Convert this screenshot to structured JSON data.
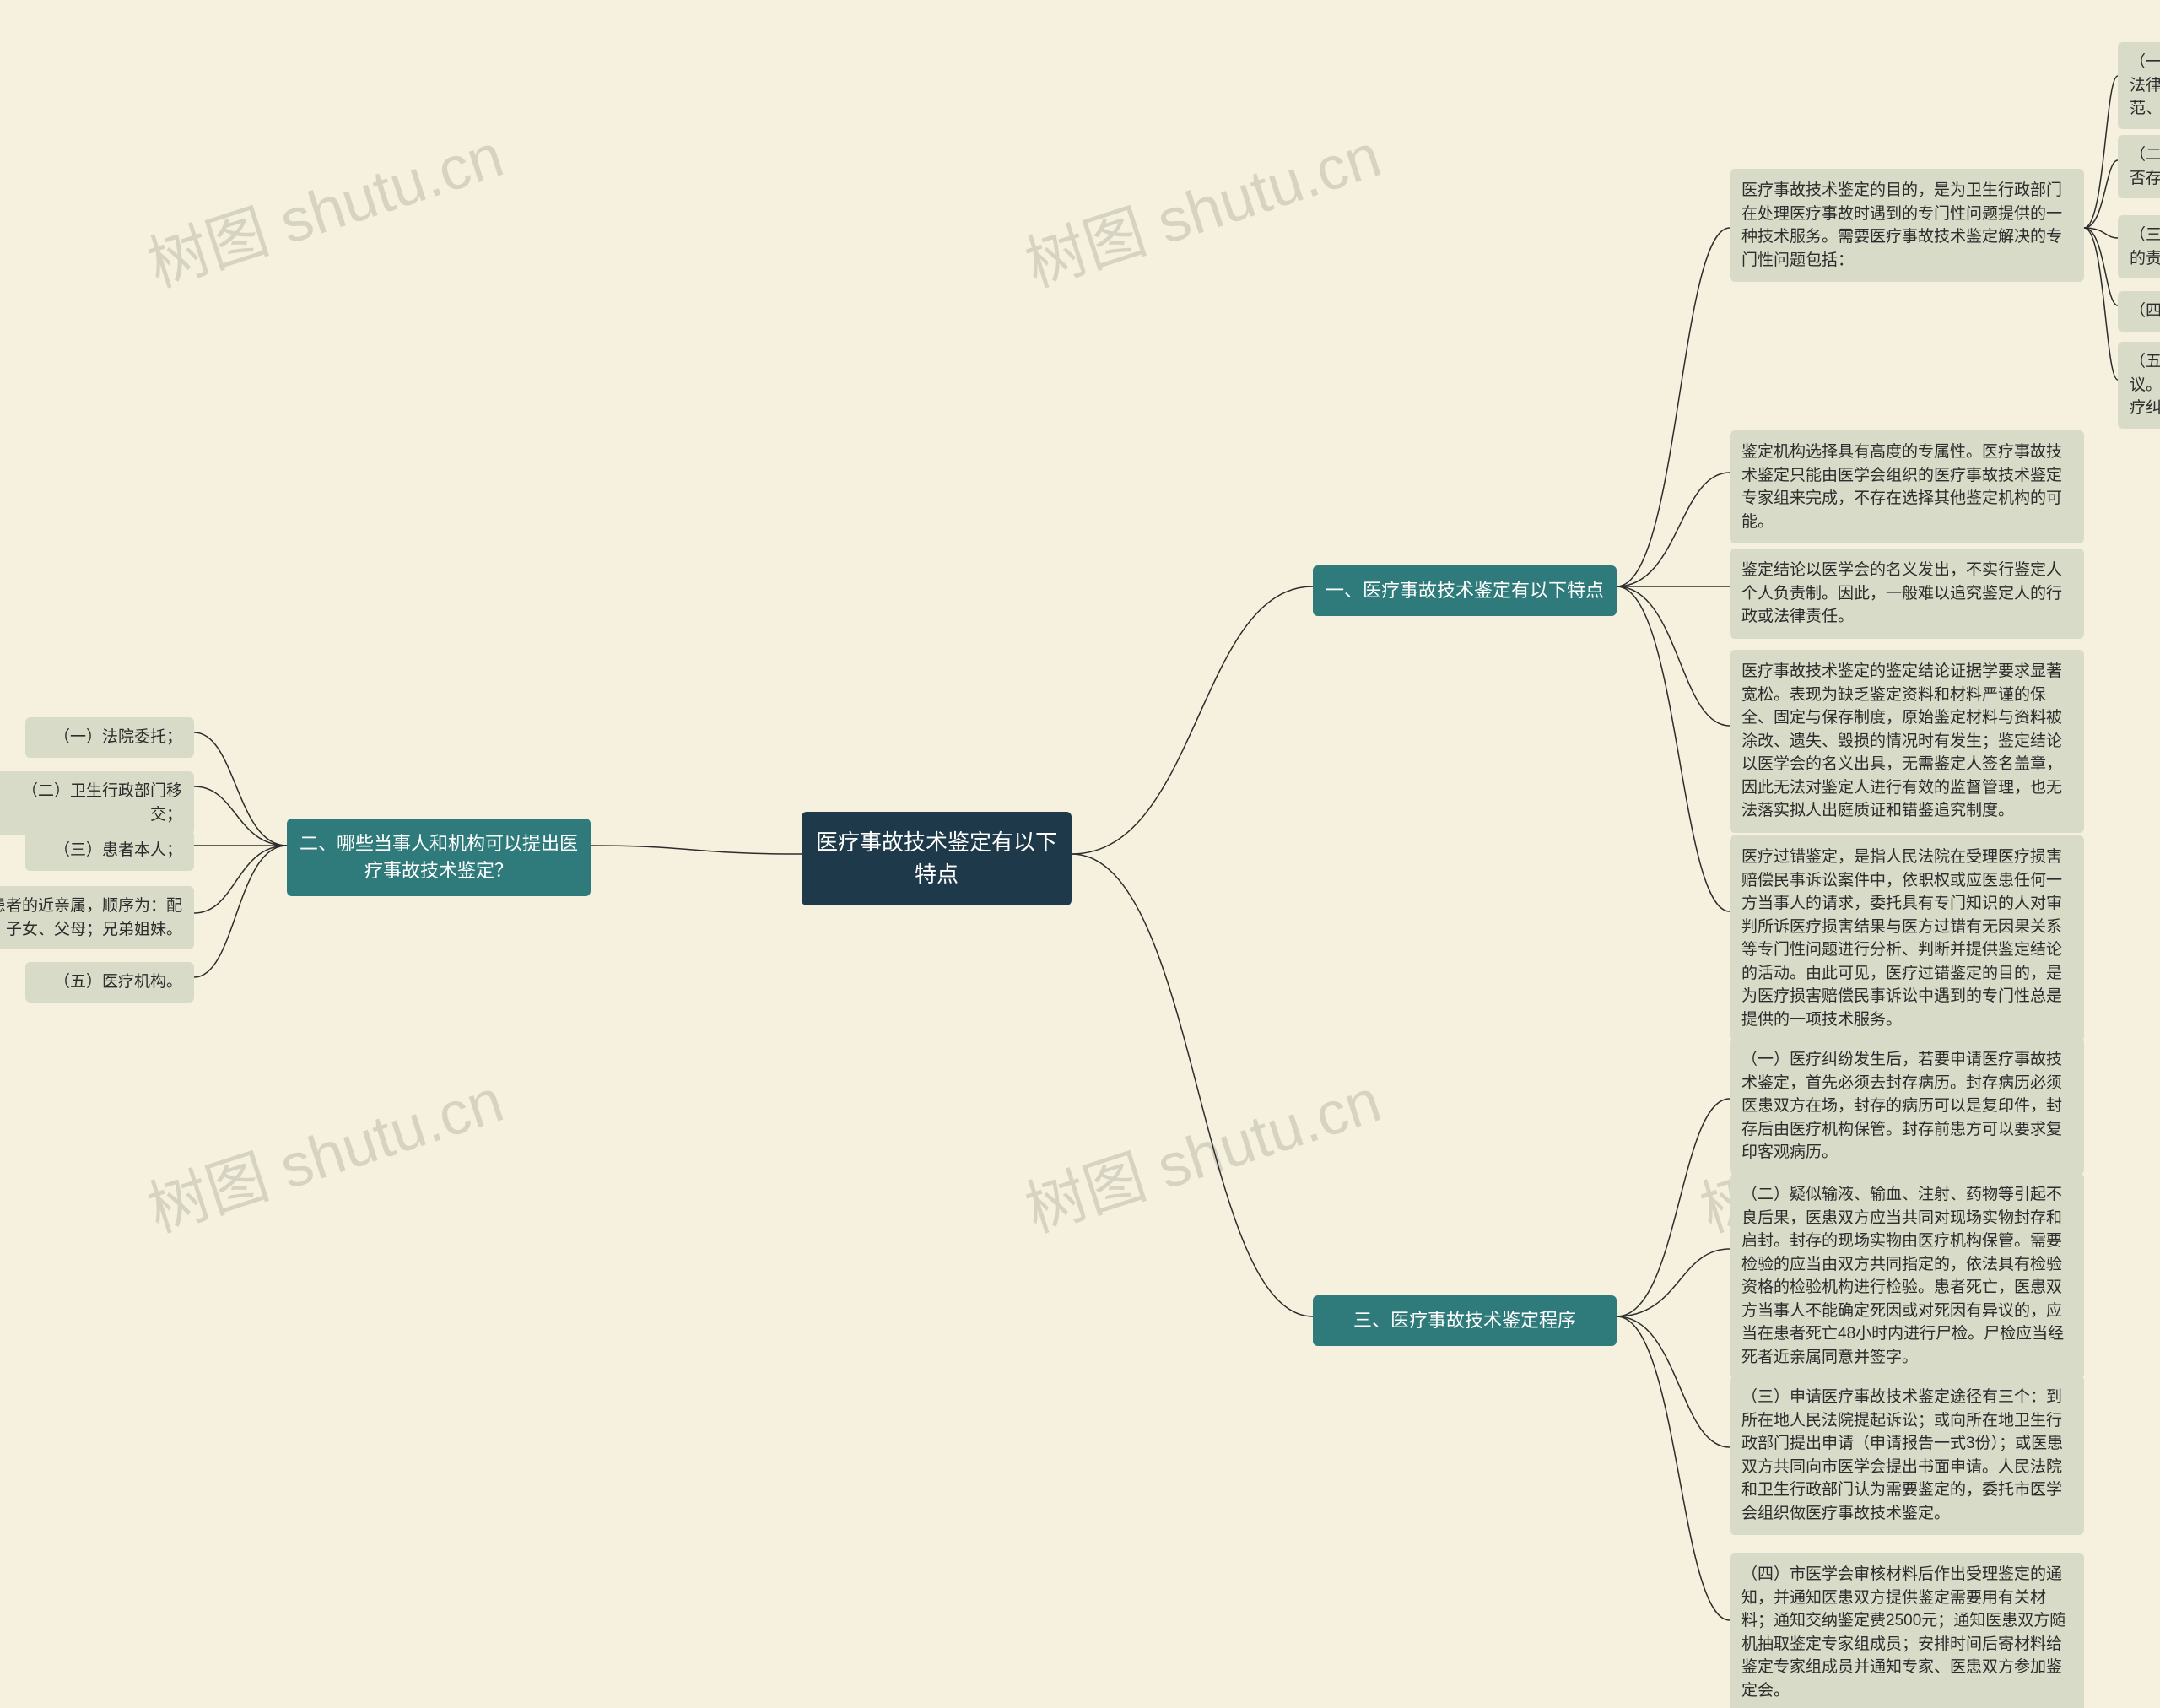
{
  "watermark": "树图 shutu.cn",
  "root": {
    "text": "医疗事故技术鉴定有以下特点"
  },
  "branches": {
    "b1": {
      "text": "一、医疗事故技术鉴定有以下特点"
    },
    "b2": {
      "text": "二、哪些当事人和机构可以提出医疗事故技术鉴定？"
    },
    "b3": {
      "text": "三、医疗事故技术鉴定程序"
    }
  },
  "b1_children": {
    "c1": {
      "text": "医疗事故技术鉴定的目的，是为卫生行政部门在处理医疗事故时遇到的专门性问题提供的一种技术服务。需要医疗事故技术鉴定解决的专门性问题包括："
    },
    "c2": {
      "text": "鉴定机构选择具有高度的专属性。医疗事故技术鉴定只能由医学会组织的医疗事故技术鉴定专家组来完成，不存在选择其他鉴定机构的可能。"
    },
    "c3": {
      "text": "鉴定结论以医学会的名义发出，不实行鉴定人个人负责制。因此，一般难以追究鉴定人的行政或法律责任。"
    },
    "c4": {
      "text": "医疗事故技术鉴定的鉴定结论证据学要求显著宽松。表现为缺乏鉴定资料和材料严谨的保全、固定与保存制度，原始鉴定材料与资料被涂改、遗失、毁损的情况时有发生；鉴定结论以医学会的名义出具，无需鉴定人签名盖章，因此无法对鉴定人进行有效的监督管理，也无法落实拟人出庭质证和错鉴追究制度。"
    },
    "c5": {
      "text": "医疗过错鉴定，是指人民法院在受理医疗损害赔偿民事诉讼案件中，依职权或应医患任何一方当事人的请求，委托具有专门知识的人对审判所诉医疗损害结果与医方过错有无因果关系等专门性问题进行分析、判断并提供鉴定结论的活动。由此可见，医疗过错鉴定的目的，是为医疗损害赔偿民事诉讼中遇到的专门性总是提供的一项技术服务。"
    }
  },
  "b1_c1_leaves": {
    "l1": {
      "text": "（一）判断医疗行为是否违反医疗卫生管理法律、行政法规、部门规章和诊疗护理规范、常规；"
    },
    "l2": {
      "text": "（二）医疗过失行为与人身损害后果之间是否存在因果关系；"
    },
    "l3": {
      "text": "（三）医疗过失行为在医疗事故损害后果中的责任程序；"
    },
    "l4": {
      "text": "（四）医疗事故等级；"
    },
    "l5": {
      "text": "（五）对医疗事故患者的医疗护理医学建议。这些专门性问题是卫生行政部门处理医疗纠纷与事故的前提与基础。"
    }
  },
  "b2_leaves": {
    "l1": {
      "text": "（一）法院委托；"
    },
    "l2": {
      "text": "（二）卫生行政部门移交；"
    },
    "l3": {
      "text": "（三）患者本人；"
    },
    "l4": {
      "text": "（四）死亡患者的近亲属，顺序为：配偶；子女、父母；兄弟姐妹。"
    },
    "l5": {
      "text": "（五）医疗机构。"
    }
  },
  "b3_leaves": {
    "l1": {
      "text": "（一）医疗纠纷发生后，若要申请医疗事故技术鉴定，首先必须去封存病历。封存病历必须医患双方在场，封存的病历可以是复印件，封存后由医疗机构保管。封存前患方可以要求复印客观病历。"
    },
    "l2": {
      "text": "（二）疑似输液、输血、注射、药物等引起不良后果，医患双方应当共同对现场实物封存和启封。封存的现场实物由医疗机构保管。需要检验的应当由双方共同指定的，依法具有检验资格的检验机构进行检验。患者死亡，医患双方当事人不能确定死因或对死因有异议的，应当在患者死亡48小时内进行尸检。尸检应当经死者近亲属同意并签字。"
    },
    "l3": {
      "text": "（三）申请医疗事故技术鉴定途径有三个：到所在地人民法院提起诉讼；或向所在地卫生行政部门提出申请（申请报告一式3份）；或医患双方共同向市医学会提出书面申请。人民法院和卫生行政部门认为需要鉴定的，委托市医学会组织做医疗事故技术鉴定。"
    },
    "l4": {
      "text": "（四）市医学会审核材料后作出受理鉴定的通知，并通知医患双方提供鉴定需要用有关材料；通知交纳鉴定费2500元；通知医患双方随机抽取鉴定专家组成员；安排时间后寄材料给鉴定专家组成员并通知专家、医患双方参加鉴定会。"
    }
  }
}
